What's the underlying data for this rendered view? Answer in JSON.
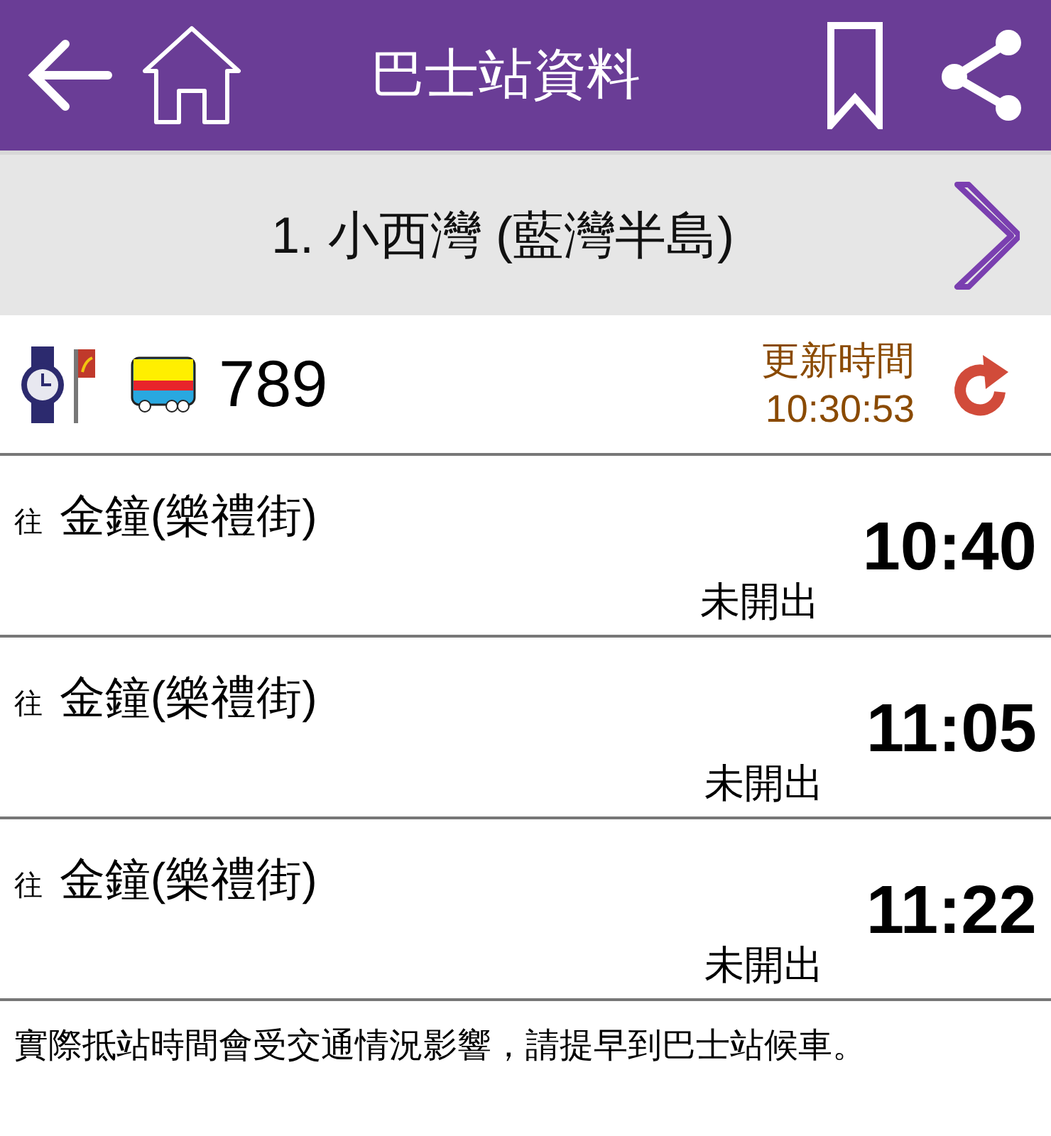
{
  "header": {
    "title": "巴士站資料"
  },
  "stop": {
    "name": "1. 小西灣 (藍灣半島)"
  },
  "route": {
    "number": "789",
    "update_label": "更新時間",
    "update_time": "10:30:53"
  },
  "departures": [
    {
      "prefix": "往",
      "destination": "金鐘(樂禮街)",
      "status": "未開出",
      "time": "10:40"
    },
    {
      "prefix": "往",
      "destination": "金鐘(樂禮街)",
      "status": "未開出",
      "time": "11:05"
    },
    {
      "prefix": "往",
      "destination": "金鐘(樂禮街)",
      "status": "未開出",
      "time": "11:22"
    }
  ],
  "note": "實際抵站時間會受交通情況影響，請提早到巴士站候車。"
}
